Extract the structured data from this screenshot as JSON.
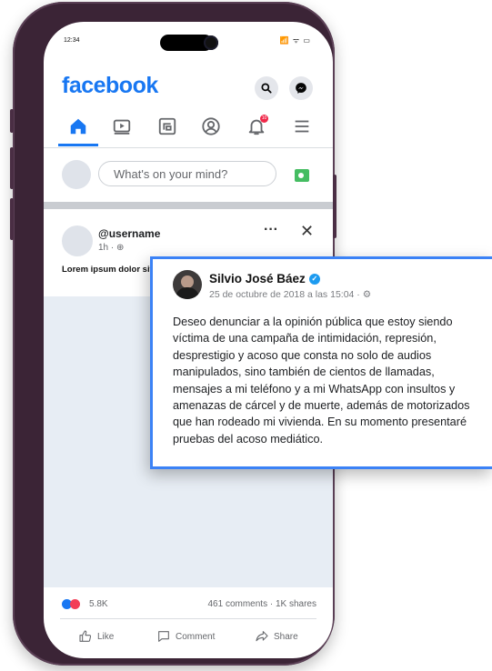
{
  "status_bar": {
    "time": "12:34",
    "icons": "📶 ᯤ ▭"
  },
  "header": {
    "logo": "facebook"
  },
  "nav": {
    "notification_badge": "10"
  },
  "composer": {
    "placeholder": "What's on your mind?"
  },
  "post": {
    "author": "@username",
    "meta": "1h · ⊕",
    "more": "···",
    "close": "✕",
    "text": "Lorem ipsum dolor sit amet, consectetuer adipiscingelit.",
    "reactions_count": "5.8K",
    "comments_shares": "461 comments · 1K shares",
    "actions": {
      "like": "Like",
      "comment": "Comment",
      "share": "Share"
    }
  },
  "card": {
    "name": "Silvio José Báez",
    "date": "25 de octubre de 2018 a las 15:04 · ⚙",
    "body": "Deseo denunciar a la opinión pública que estoy siendo víctima de una campaña de intimidación, represión, desprestigio y acoso que consta no solo de audios manipulados, sino también de cientos de llamadas, mensajes a mi teléfono y a mi WhatsApp con insultos y amenazas de cárcel y de muerte, además de motorizados que han rodeado mi vivienda. En su momento presentaré pruebas del acoso mediático."
  },
  "colors": {
    "brand": "#1877f2",
    "card_border": "#3b82f6",
    "frame": "#3b2436"
  }
}
